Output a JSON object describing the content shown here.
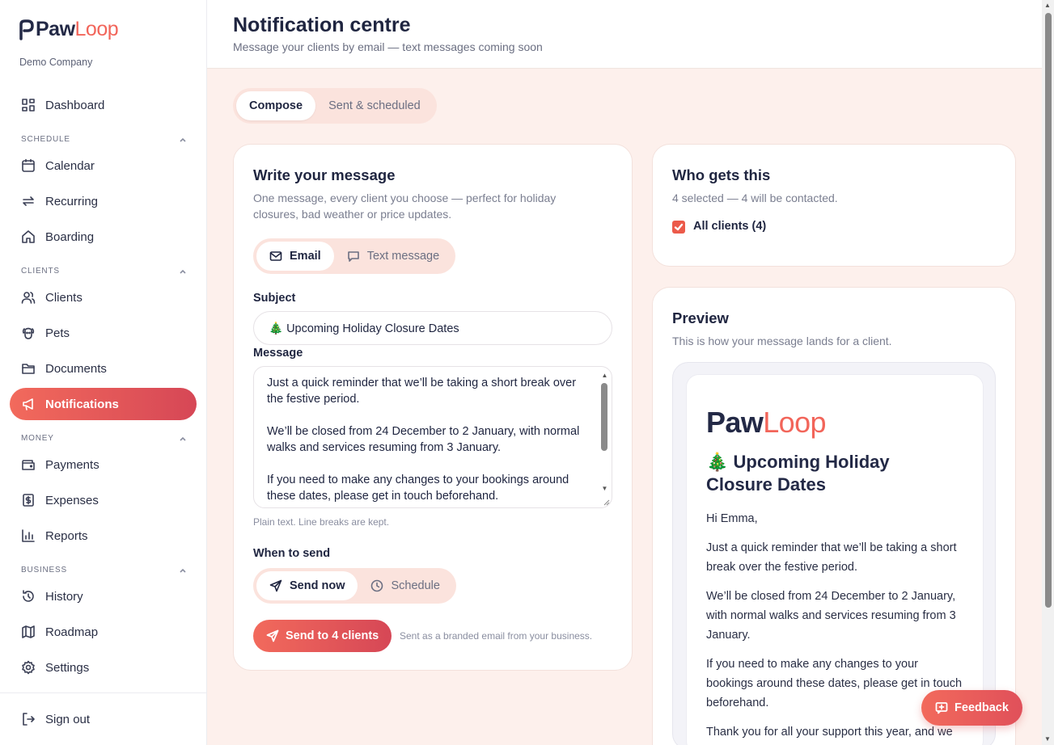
{
  "brand": {
    "name_part1": "Paw",
    "name_part2": "Loop",
    "company": "Demo Company"
  },
  "nav": {
    "dashboard": "Dashboard",
    "section_schedule": "SCHEDULE",
    "calendar": "Calendar",
    "recurring": "Recurring",
    "boarding": "Boarding",
    "section_clients": "CLIENTS",
    "clients": "Clients",
    "pets": "Pets",
    "documents": "Documents",
    "notifications": "Notifications",
    "section_money": "MONEY",
    "payments": "Payments",
    "expenses": "Expenses",
    "reports": "Reports",
    "section_business": "BUSINESS",
    "history": "History",
    "roadmap": "Roadmap",
    "settings": "Settings",
    "sign_out": "Sign out"
  },
  "header": {
    "title": "Notification centre",
    "subtitle": "Message your clients by email — text messages coming soon"
  },
  "tabs": {
    "compose": "Compose",
    "sent": "Sent & scheduled"
  },
  "compose": {
    "title": "Write your message",
    "description": "One message, every client you choose — perfect for holiday closures, bad weather or price updates.",
    "channel_email": "Email",
    "channel_text": "Text message",
    "subject_label": "Subject",
    "subject_value": "🎄 Upcoming Holiday Closure Dates",
    "message_label": "Message",
    "message_value": "Just a quick reminder that we’ll be taking a short break over the festive period.\n\nWe’ll be closed from 24 December to 2 January, with normal walks and services resuming from 3 January.\n\nIf you need to make any changes to your bookings around these dates, please get in touch beforehand.",
    "message_hint": "Plain text. Line breaks are kept.",
    "when_label": "When to send",
    "send_now": "Send now",
    "schedule": "Schedule",
    "send_button": "Send to 4 clients",
    "send_note": "Sent as a branded email from your business."
  },
  "recipients": {
    "title": "Who gets this",
    "summary": "4 selected — 4 will be contacted.",
    "all_clients": "All clients (4)",
    "all_clients_checked": true
  },
  "preview": {
    "title": "Preview",
    "description": "This is how your message lands for a client.",
    "logo_part1": "Paw",
    "logo_part2": "Loop",
    "mail_title": "🎄 Upcoming Holiday Closure Dates",
    "greeting": "Hi Emma,",
    "p1": "Just a quick reminder that we’ll be taking a short break over the festive period.",
    "p2": "We’ll be closed from 24 December to 2 January, with normal walks and services resuming from 3 January.",
    "p3": "If you need to make any changes to your bookings around these dates, please get in touch beforehand.",
    "p4": "Thank you for all your support this year, and we hope you and your pups have a wonderful"
  },
  "feedback": "Feedback",
  "colors": {
    "accent": "#f26a5c",
    "accent_dark": "#d64756",
    "navy": "#1f2540",
    "bg_tint": "#fdf0ec"
  }
}
